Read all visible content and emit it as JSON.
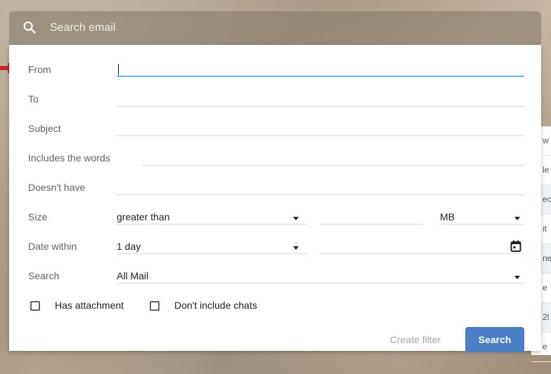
{
  "search": {
    "placeholder": "Search email",
    "icon": "search-icon"
  },
  "fields": {
    "from_label": "From",
    "from_value": "",
    "to_label": "To",
    "to_value": "",
    "subject_label": "Subject",
    "subject_value": "",
    "includes_label": "Includes the words",
    "includes_value": "",
    "doesnt_label": "Doesn't have",
    "doesnt_value": ""
  },
  "size": {
    "label": "Size",
    "comparator": "greater than",
    "amount": "",
    "unit": "MB"
  },
  "date": {
    "label": "Date within",
    "range": "1 day",
    "date_value": ""
  },
  "search_scope": {
    "label": "Search",
    "value": "All Mail"
  },
  "options": {
    "has_attachment": "Has attachment",
    "dont_include_chats": "Don't include chats"
  },
  "actions": {
    "create_filter": "Create filter",
    "search": "Search"
  },
  "background_list": [
    "w",
    "le",
    "ec",
    "it",
    "ne",
    "e",
    "2l",
    "e"
  ],
  "colors": {
    "accent": "#4a7fc7",
    "active_underline": "#1a73e8",
    "pointer_arrow": "#c62828"
  }
}
